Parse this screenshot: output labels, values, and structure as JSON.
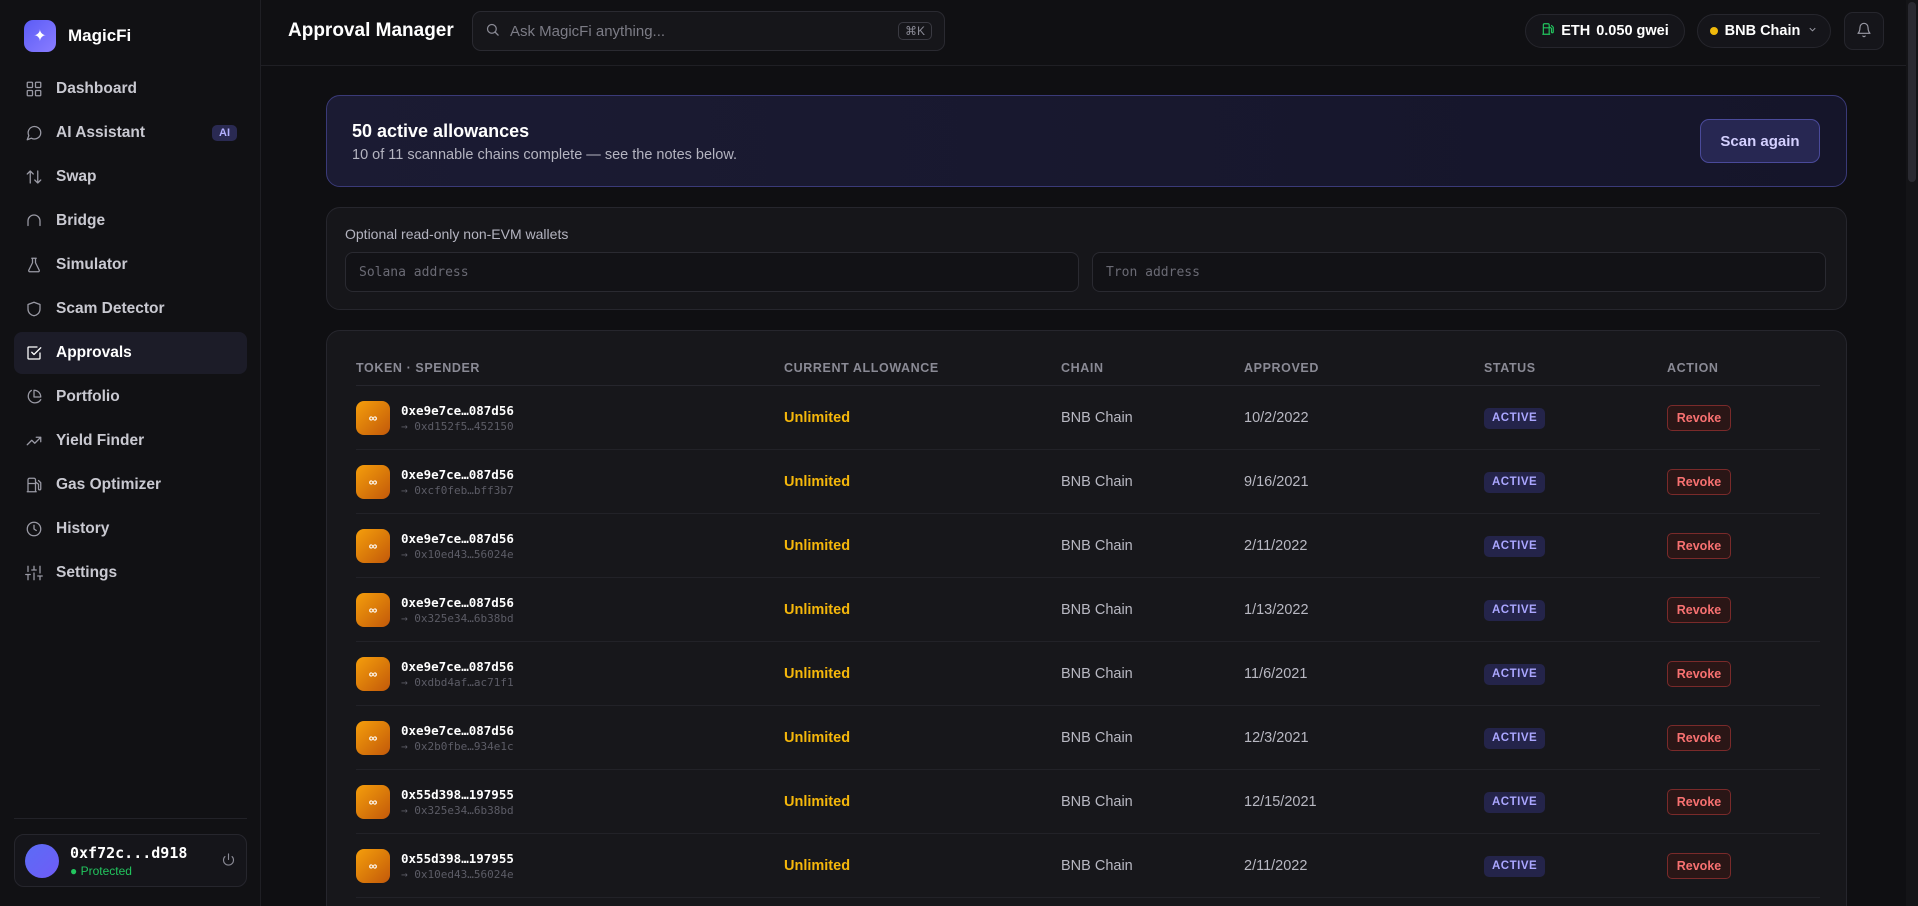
{
  "brand": {
    "name": "MagicFi",
    "logo_icon": "sparkle-icon",
    "accent": "#5b5cf6"
  },
  "sidebar": {
    "items": [
      {
        "label": "Dashboard",
        "icon": "grid-icon",
        "active": false
      },
      {
        "label": "AI Assistant",
        "icon": "chat-icon",
        "active": false,
        "badge": "AI"
      },
      {
        "label": "Swap",
        "icon": "swap-arrows-icon",
        "active": false
      },
      {
        "label": "Bridge",
        "icon": "bridge-icon",
        "active": false
      },
      {
        "label": "Simulator",
        "icon": "flask-icon",
        "active": false
      },
      {
        "label": "Scam Detector",
        "icon": "shield-icon",
        "active": false
      },
      {
        "label": "Approvals",
        "icon": "checkbox-icon",
        "active": true
      },
      {
        "label": "Portfolio",
        "icon": "pie-chart-icon",
        "active": false
      },
      {
        "label": "Yield Finder",
        "icon": "trending-up-icon",
        "active": false
      },
      {
        "label": "Gas Optimizer",
        "icon": "fuel-icon",
        "active": false
      },
      {
        "label": "History",
        "icon": "clock-icon",
        "active": false
      },
      {
        "label": "Settings",
        "icon": "sliders-icon",
        "active": false
      }
    ]
  },
  "user": {
    "address": "0xf72c...d918",
    "status": "● Protected"
  },
  "header": {
    "title": "Approval Manager",
    "search_placeholder": "Ask MagicFi anything...",
    "search_shortcut": "⌘K",
    "gas_label": "ETH",
    "gas_value": "0.050 gwei",
    "chain": "BNB Chain",
    "chain_color": "#f0b90b"
  },
  "summary": {
    "title": "50 active allowances",
    "subtitle": "10 of 11 scannable chains complete — see the notes below.",
    "scan_button": "Scan again"
  },
  "wallets": {
    "label": "Optional read-only non-EVM wallets",
    "solana_placeholder": "Solana address",
    "tron_placeholder": "Tron address"
  },
  "table": {
    "columns": [
      "TOKEN · SPENDER",
      "CURRENT ALLOWANCE",
      "CHAIN",
      "APPROVED",
      "STATUS",
      "ACTION"
    ],
    "rows": [
      {
        "token": "0xe9e7ce…087d56",
        "spender": "→ 0xd152f5…452150",
        "allowance": "Unlimited",
        "chain": "BNB Chain",
        "approved": "10/2/2022",
        "status": "ACTIVE",
        "action": "Revoke"
      },
      {
        "token": "0xe9e7ce…087d56",
        "spender": "→ 0xcf0feb…bff3b7",
        "allowance": "Unlimited",
        "chain": "BNB Chain",
        "approved": "9/16/2021",
        "status": "ACTIVE",
        "action": "Revoke"
      },
      {
        "token": "0xe9e7ce…087d56",
        "spender": "→ 0x10ed43…56024e",
        "allowance": "Unlimited",
        "chain": "BNB Chain",
        "approved": "2/11/2022",
        "status": "ACTIVE",
        "action": "Revoke"
      },
      {
        "token": "0xe9e7ce…087d56",
        "spender": "→ 0x325e34…6b38bd",
        "allowance": "Unlimited",
        "chain": "BNB Chain",
        "approved": "1/13/2022",
        "status": "ACTIVE",
        "action": "Revoke"
      },
      {
        "token": "0xe9e7ce…087d56",
        "spender": "→ 0xdbd4af…ac71f1",
        "allowance": "Unlimited",
        "chain": "BNB Chain",
        "approved": "11/6/2021",
        "status": "ACTIVE",
        "action": "Revoke"
      },
      {
        "token": "0xe9e7ce…087d56",
        "spender": "→ 0x2b0fbe…934e1c",
        "allowance": "Unlimited",
        "chain": "BNB Chain",
        "approved": "12/3/2021",
        "status": "ACTIVE",
        "action": "Revoke"
      },
      {
        "token": "0x55d398…197955",
        "spender": "→ 0x325e34…6b38bd",
        "allowance": "Unlimited",
        "chain": "BNB Chain",
        "approved": "12/15/2021",
        "status": "ACTIVE",
        "action": "Revoke"
      },
      {
        "token": "0x55d398…197955",
        "spender": "→ 0x10ed43…56024e",
        "allowance": "Unlimited",
        "chain": "BNB Chain",
        "approved": "2/11/2022",
        "status": "ACTIVE",
        "action": "Revoke"
      }
    ],
    "token_icon_glyph": "∞"
  }
}
